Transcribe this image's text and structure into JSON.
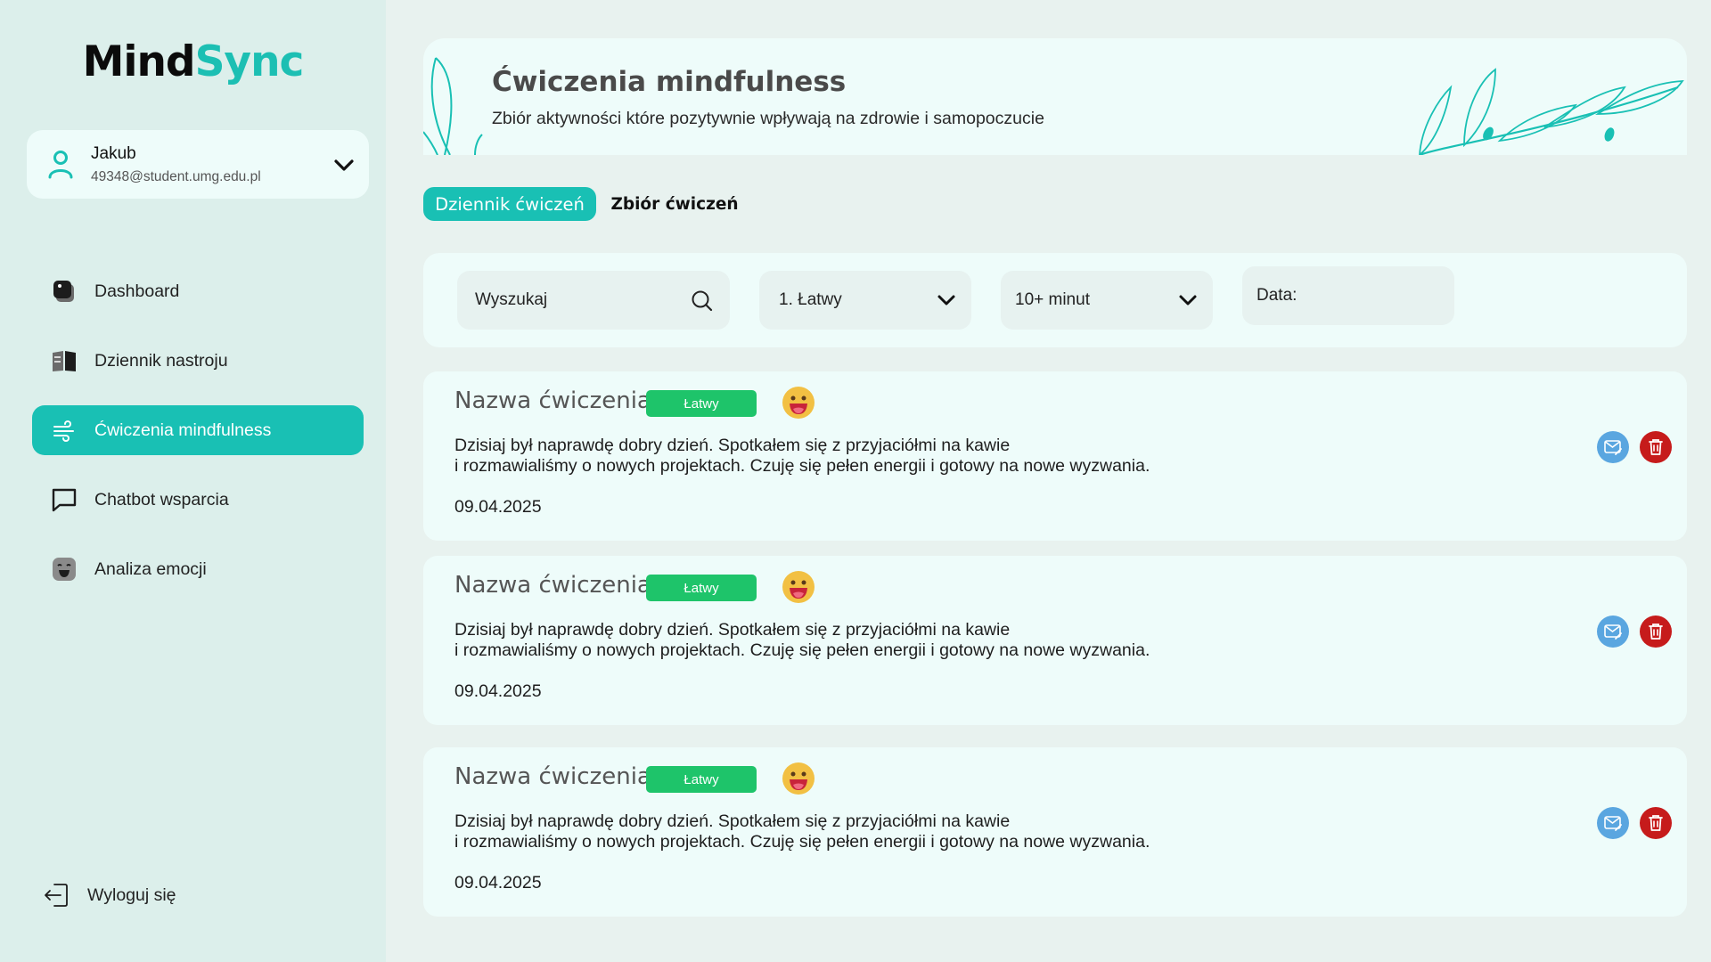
{
  "app": {
    "logo_part1": "Mind",
    "logo_part2": "Sync",
    "accent_color": "#19c0b4"
  },
  "user": {
    "name": "Jakub",
    "email": "49348@student.umg.edu.pl"
  },
  "sidebar": {
    "items": [
      {
        "label": "Dashboard",
        "icon": "dashboard-icon"
      },
      {
        "label": "Dziennik nastroju",
        "icon": "book-icon"
      },
      {
        "label": "Ćwiczenia mindfulness",
        "icon": "wind-icon",
        "active": true
      },
      {
        "label": "Chatbot wsparcia",
        "icon": "chat-icon"
      },
      {
        "label": "Analiza emocji",
        "icon": "emotion-face-icon"
      }
    ],
    "logout_label": "Wyloguj się"
  },
  "banner": {
    "title": "Ćwiczenia mindfulness",
    "subtitle": "Zbiór aktywności które pozytywnie wpływają na zdrowie i samopoczucie"
  },
  "tabs": [
    {
      "label": "Dziennik ćwiczeń",
      "active": true
    },
    {
      "label": "Zbiór ćwiczeń",
      "active": false
    }
  ],
  "filters": {
    "search_placeholder": "Wyszukaj",
    "level_selected": "1. Łatwy",
    "duration_selected": "10+ minut",
    "date_label": "Data:"
  },
  "entries": [
    {
      "title": "Nazwa ćwiczenia",
      "badge": "Łatwy",
      "text_line1": "Dzisiaj był naprawdę dobry dzień. Spotkałem się z przyjaciółmi na kawie",
      "text_line2": "i rozmawialiśmy o nowych projektach. Czuję się pełen energii i gotowy na nowe wyzwania.",
      "date": "09.04.2025"
    },
    {
      "title": "Nazwa ćwiczenia",
      "badge": "Łatwy",
      "text_line1": "Dzisiaj był naprawdę dobry dzień. Spotkałem się z przyjaciółmi na kawie",
      "text_line2": "i rozmawialiśmy o nowych projektach. Czuję się pełen energii i gotowy na nowe wyzwania.",
      "date": "09.04.2025"
    },
    {
      "title": "Nazwa ćwiczenia",
      "badge": "Łatwy",
      "text_line1": "Dzisiaj był naprawdę dobry dzień. Spotkałem się z przyjaciółmi na kawie",
      "text_line2": "i rozmawialiśmy o nowych projektach. Czuję się pełen energii i gotowy na nowe wyzwania.",
      "date": "09.04.2025"
    }
  ]
}
